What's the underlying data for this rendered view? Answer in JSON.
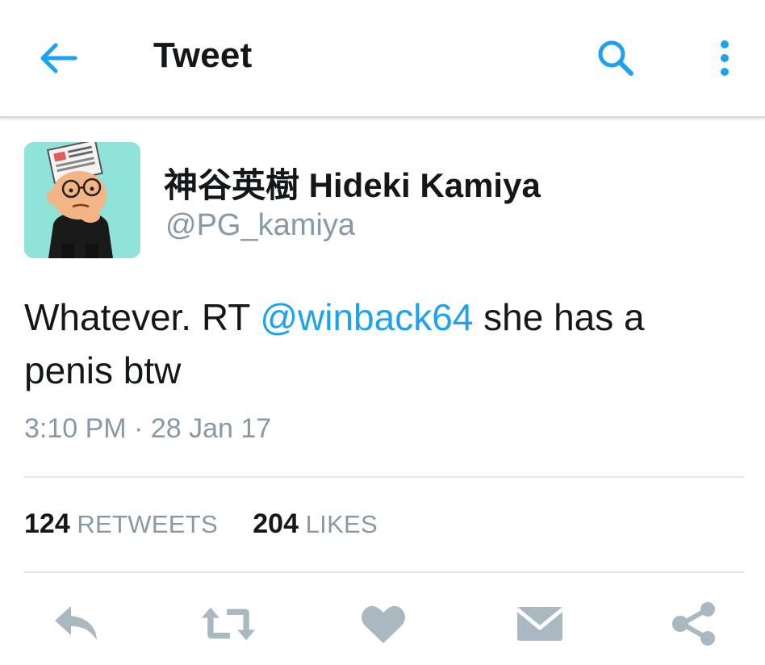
{
  "header": {
    "title": "Tweet",
    "back_icon": "arrow-left-icon",
    "search_icon": "search-icon",
    "more_icon": "more-vertical-icon"
  },
  "tweet": {
    "avatar_icon": "cartoon-avatar",
    "display_name": "神谷英樹 Hideki Kamiya",
    "handle": "@PG_kamiya",
    "text_before": "Whatever. RT ",
    "mention": "@winback64",
    "text_after": " she has a penis btw",
    "timestamp": "3:10 PM · 28 Jan 17"
  },
  "stats": {
    "retweets_count": "124",
    "retweets_label": "RETWEETS",
    "likes_count": "204",
    "likes_label": "LIKES"
  },
  "actions": [
    {
      "name": "reply",
      "icon": "reply-icon"
    },
    {
      "name": "retweet",
      "icon": "retweet-icon"
    },
    {
      "name": "like",
      "icon": "heart-icon"
    },
    {
      "name": "direct-message",
      "icon": "envelope-icon"
    },
    {
      "name": "share",
      "icon": "share-icon"
    }
  ],
  "colors": {
    "accent": "#1da1f2",
    "muted": "#8899a6",
    "icon_gray": "#aab8c2",
    "text": "#14171a"
  }
}
